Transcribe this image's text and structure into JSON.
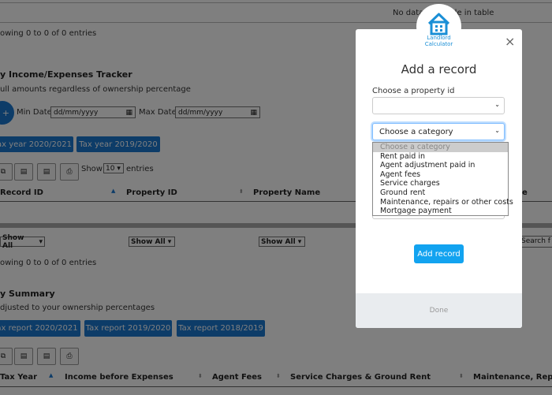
{
  "page": {
    "top_table_empty": "No data available in table",
    "showing_1": "owing 0 to 0 of 0 entries",
    "tracker_title": "y Income/Expenses Tracker",
    "tracker_subtitle": "ull amounts regardless of ownership percentage",
    "min_date_label": "Min Date:",
    "max_date_label": "Max Date:",
    "date_placeholder": "dd/mm/yyyy",
    "tax_year_buttons": [
      "ax year 2020/2021",
      "Tax year 2019/2020"
    ],
    "show_label": "Show",
    "show_value": "10",
    "entries_label": "entries",
    "table1_headers": [
      "Record ID",
      "Property ID",
      "Property Name",
      "e"
    ],
    "filter_label": "Show All",
    "search_label": "Search f",
    "showing_2": "owing 0 to 0 of 0 entries",
    "summary_title": "y Summary",
    "summary_subtitle": "djusted to your ownership percentages",
    "tax_report_buttons": [
      "ax report 2020/2021",
      "Tax report 2019/2020",
      "Tax report 2018/2019"
    ],
    "table2_headers": [
      "Tax Year",
      "Income before Expenses",
      "Agent Fees",
      "Service Charges & Ground Rent",
      "Maintenance, Repai"
    ]
  },
  "modal": {
    "logo_line1": "Landlord",
    "logo_line2": "Calculator",
    "close_label": "×",
    "title": "Add a record",
    "property_label": "Choose a property id",
    "category_value": "Choose a category",
    "category_options": [
      "Choose a category",
      "Rent paid in",
      "Agent adjustment paid in",
      "Agent fees",
      "Service charges",
      "Ground rent",
      "Maintenance, repairs or other costs",
      "Mortgage payment"
    ],
    "add_button": "Add record",
    "done_button": "Done"
  },
  "colors": {
    "primary": "#1a78d1",
    "modal_button": "#12a3f0",
    "overlay": "rgba(0,0,0,0.5)"
  }
}
